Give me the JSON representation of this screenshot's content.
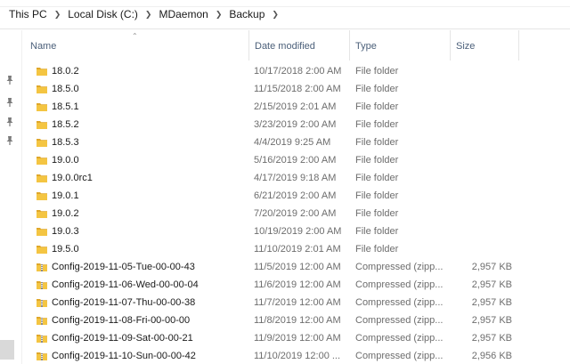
{
  "breadcrumb": [
    "This PC",
    "Local Disk (C:)",
    "MDaemon",
    "Backup"
  ],
  "columns": {
    "name": "Name",
    "date": "Date modified",
    "type": "Type",
    "size": "Size"
  },
  "rows": [
    {
      "name": "18.0.2",
      "date": "10/17/2018 2:00 AM",
      "type": "File folder",
      "size": "",
      "icon": "folder-icon"
    },
    {
      "name": "18.5.0",
      "date": "11/15/2018 2:00 AM",
      "type": "File folder",
      "size": "",
      "icon": "folder-icon"
    },
    {
      "name": "18.5.1",
      "date": "2/15/2019 2:01 AM",
      "type": "File folder",
      "size": "",
      "icon": "folder-icon"
    },
    {
      "name": "18.5.2",
      "date": "3/23/2019 2:00 AM",
      "type": "File folder",
      "size": "",
      "icon": "folder-icon"
    },
    {
      "name": "18.5.3",
      "date": "4/4/2019 9:25 AM",
      "type": "File folder",
      "size": "",
      "icon": "folder-icon"
    },
    {
      "name": "19.0.0",
      "date": "5/16/2019 2:00 AM",
      "type": "File folder",
      "size": "",
      "icon": "folder-icon"
    },
    {
      "name": "19.0.0rc1",
      "date": "4/17/2019 9:18 AM",
      "type": "File folder",
      "size": "",
      "icon": "folder-icon"
    },
    {
      "name": "19.0.1",
      "date": "6/21/2019 2:00 AM",
      "type": "File folder",
      "size": "",
      "icon": "folder-icon"
    },
    {
      "name": "19.0.2",
      "date": "7/20/2019 2:00 AM",
      "type": "File folder",
      "size": "",
      "icon": "folder-icon"
    },
    {
      "name": "19.0.3",
      "date": "10/19/2019 2:00 AM",
      "type": "File folder",
      "size": "",
      "icon": "folder-icon"
    },
    {
      "name": "19.5.0",
      "date": "11/10/2019 2:01 AM",
      "type": "File folder",
      "size": "",
      "icon": "folder-icon"
    },
    {
      "name": "Config-2019-11-05-Tue-00-00-43",
      "date": "11/5/2019 12:00 AM",
      "type": "Compressed (zipp...",
      "size": "2,957 KB",
      "icon": "zip-folder-icon"
    },
    {
      "name": "Config-2019-11-06-Wed-00-00-04",
      "date": "11/6/2019 12:00 AM",
      "type": "Compressed (zipp...",
      "size": "2,957 KB",
      "icon": "zip-folder-icon"
    },
    {
      "name": "Config-2019-11-07-Thu-00-00-38",
      "date": "11/7/2019 12:00 AM",
      "type": "Compressed (zipp...",
      "size": "2,957 KB",
      "icon": "zip-folder-icon"
    },
    {
      "name": "Config-2019-11-08-Fri-00-00-00",
      "date": "11/8/2019 12:00 AM",
      "type": "Compressed (zipp...",
      "size": "2,957 KB",
      "icon": "zip-folder-icon"
    },
    {
      "name": "Config-2019-11-09-Sat-00-00-21",
      "date": "11/9/2019 12:00 AM",
      "type": "Compressed (zipp...",
      "size": "2,957 KB",
      "icon": "zip-folder-icon"
    },
    {
      "name": "Config-2019-11-10-Sun-00-00-42",
      "date": "11/10/2019 12:00 ...",
      "type": "Compressed (zipp...",
      "size": "2,956 KB",
      "icon": "zip-folder-icon"
    }
  ],
  "colors": {
    "folder": "#f4c542",
    "folder_dark": "#dfa72a",
    "header_text": "#4c607a",
    "secondary_text": "#6d6d6d"
  },
  "pins": [
    "pin-icon",
    "pin-icon",
    "pin-icon",
    "pin-icon"
  ]
}
